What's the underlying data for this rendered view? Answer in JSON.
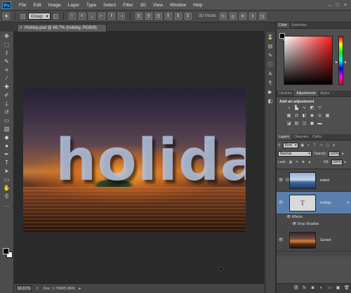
{
  "app": {
    "logo": "Ps"
  },
  "menu": [
    "File",
    "Edit",
    "Image",
    "Layer",
    "Type",
    "Select",
    "Filter",
    "3D",
    "View",
    "Window",
    "Help"
  ],
  "window_controls": [
    "–",
    "□",
    "×"
  ],
  "options": {
    "auto_select_target": "Group",
    "mode_label": "3D Mode:"
  },
  "document": {
    "tab_title": "Holiday.psd @ 66.7% (holiday, RGB/8)",
    "close_glyph": "×"
  },
  "canvas": {
    "text": "holiday"
  },
  "status": {
    "zoom": "66.67%",
    "doc_info": "Doc: 1.79M/5.96M"
  },
  "panels": {
    "color_tabs": [
      "Color",
      "Swatches"
    ],
    "adj_tabs": [
      "Libraries",
      "Adjustments",
      "Styles"
    ],
    "adj_title": "Add an adjustment",
    "layer_tabs": [
      "Layers",
      "Channels",
      "Paths"
    ],
    "kind_filter": "Kind",
    "blend_mode": "Normal",
    "opacity_label": "Opacity:",
    "opacity_value": "100%",
    "lock_label": "Lock:",
    "fill_label": "Fill:",
    "fill_value": "100%"
  },
  "layers": [
    {
      "name": "island",
      "fx": ""
    },
    {
      "name": "holiday",
      "fx": "fx",
      "thumb_letter": "T"
    },
    {
      "name": "Sunset",
      "fx": ""
    }
  ],
  "effects": {
    "label": "Effects",
    "drop_shadow": "Drop Shadow"
  },
  "colors": {
    "accent": "#3b72b8",
    "selected_layer": "#5a7fae",
    "canvas_bg": "#2b2b2b"
  }
}
